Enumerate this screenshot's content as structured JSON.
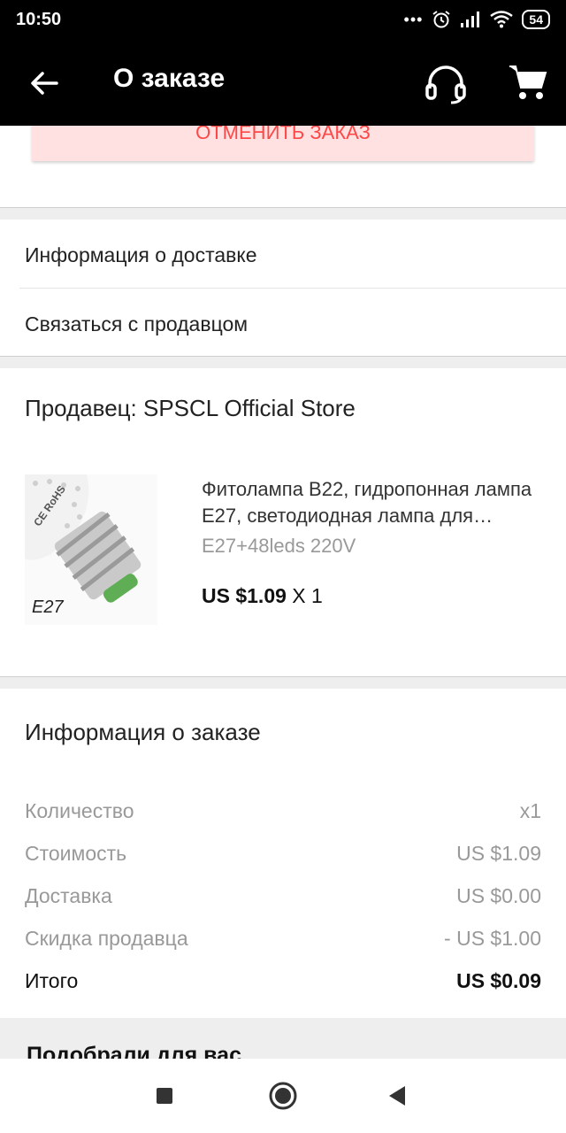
{
  "status_bar": {
    "time": "10:50",
    "signal_dots": "•••",
    "battery": "54",
    "icons": [
      "alarm-icon",
      "signal-icon",
      "wifi-icon",
      "battery-icon"
    ]
  },
  "app_bar": {
    "title": "О заказе",
    "icons": [
      "back-arrow-icon",
      "support-headset-icon",
      "cart-icon"
    ]
  },
  "cancel_button": {
    "label": "ОТМЕНИТЬ ЗАКАЗ"
  },
  "menu": {
    "items": [
      {
        "label": "Информация о доставке"
      },
      {
        "label": "Связаться с продавцом"
      }
    ]
  },
  "seller": {
    "title": "Продавец: SPSCL Official Store",
    "product": {
      "name": "Фитолампа B22, гидропонная лампа E27, светодиодная лампа для выращивания растений",
      "variant": "E27+48leds 220V",
      "price": "US $1.09",
      "quantity": "X 1",
      "image_label": "E27",
      "image_stamp": "CE RoHS"
    }
  },
  "order_info": {
    "title": "Информация о заказе",
    "rows": [
      {
        "label": "Количество",
        "value": "x1"
      },
      {
        "label": "Стоимость",
        "value": "US $1.09"
      },
      {
        "label": "Доставка",
        "value": "US $0.00"
      },
      {
        "label": "Скидка продавца",
        "value": "- US $1.00"
      },
      {
        "label": "Итого",
        "value": "US $0.09"
      }
    ]
  },
  "recommendations": {
    "title": "Подобрали для вас"
  },
  "colors": {
    "appbar": "#000000",
    "cancel_bg": "#ffe1e1",
    "cancel_text": "#ff4747",
    "separator": "#eeeeee"
  }
}
